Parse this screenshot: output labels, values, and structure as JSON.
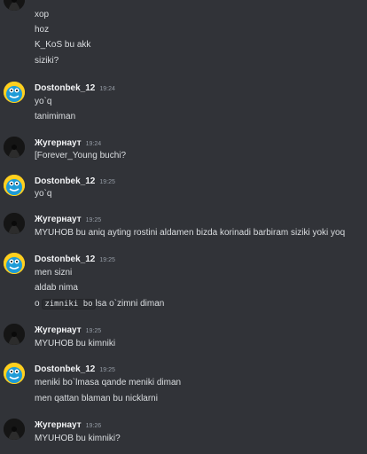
{
  "messages": [
    {
      "author": "",
      "time": "",
      "avatar": "dark-hooded-avatar",
      "lines": [
        "xop",
        "hoz",
        "K_KoS bu akk",
        "siziki?"
      ]
    },
    {
      "author": "Dostonbek_12",
      "time": "19:24",
      "avatar": "blue-monster-avatar",
      "lines": [
        "yo`q",
        "tanimiman"
      ]
    },
    {
      "author": "Жугернаут",
      "time": "19:24",
      "avatar": "dark-hooded-avatar",
      "lines": [
        "[Forever_Young buchi?"
      ]
    },
    {
      "author": "Dostonbek_12",
      "time": "19:25",
      "avatar": "blue-monster-avatar",
      "lines": [
        "yo`q"
      ]
    },
    {
      "author": "Жугернаут",
      "time": "19:25",
      "avatar": "dark-hooded-avatar",
      "lines": [
        "MYUHOB bu aniq ayting rostini aldamen bizda korinadi barbiram siziki yoki yoq"
      ]
    },
    {
      "author": "Dostonbek_12",
      "time": "19:25",
      "avatar": "blue-monster-avatar",
      "lines": [
        "men sizni",
        "aldab nima"
      ],
      "code_line": {
        "prefix": "o",
        "code": "zimniki bo",
        "suffix": "lsa o`zimni diman"
      }
    },
    {
      "author": "Жугернаут",
      "time": "19:25",
      "avatar": "dark-hooded-avatar",
      "lines": [
        "MYUHOB bu kimniki"
      ]
    },
    {
      "author": "Dostonbek_12",
      "time": "19:25",
      "avatar": "blue-monster-avatar",
      "lines": [
        "meniki bo`lmasa qande meniki diman",
        "men qattan blaman bu nicklarni"
      ]
    },
    {
      "author": "Жугернаут",
      "time": "19:26",
      "avatar": "dark-hooded-avatar",
      "lines": [
        "MYUHOB bu kimniki?"
      ]
    }
  ]
}
